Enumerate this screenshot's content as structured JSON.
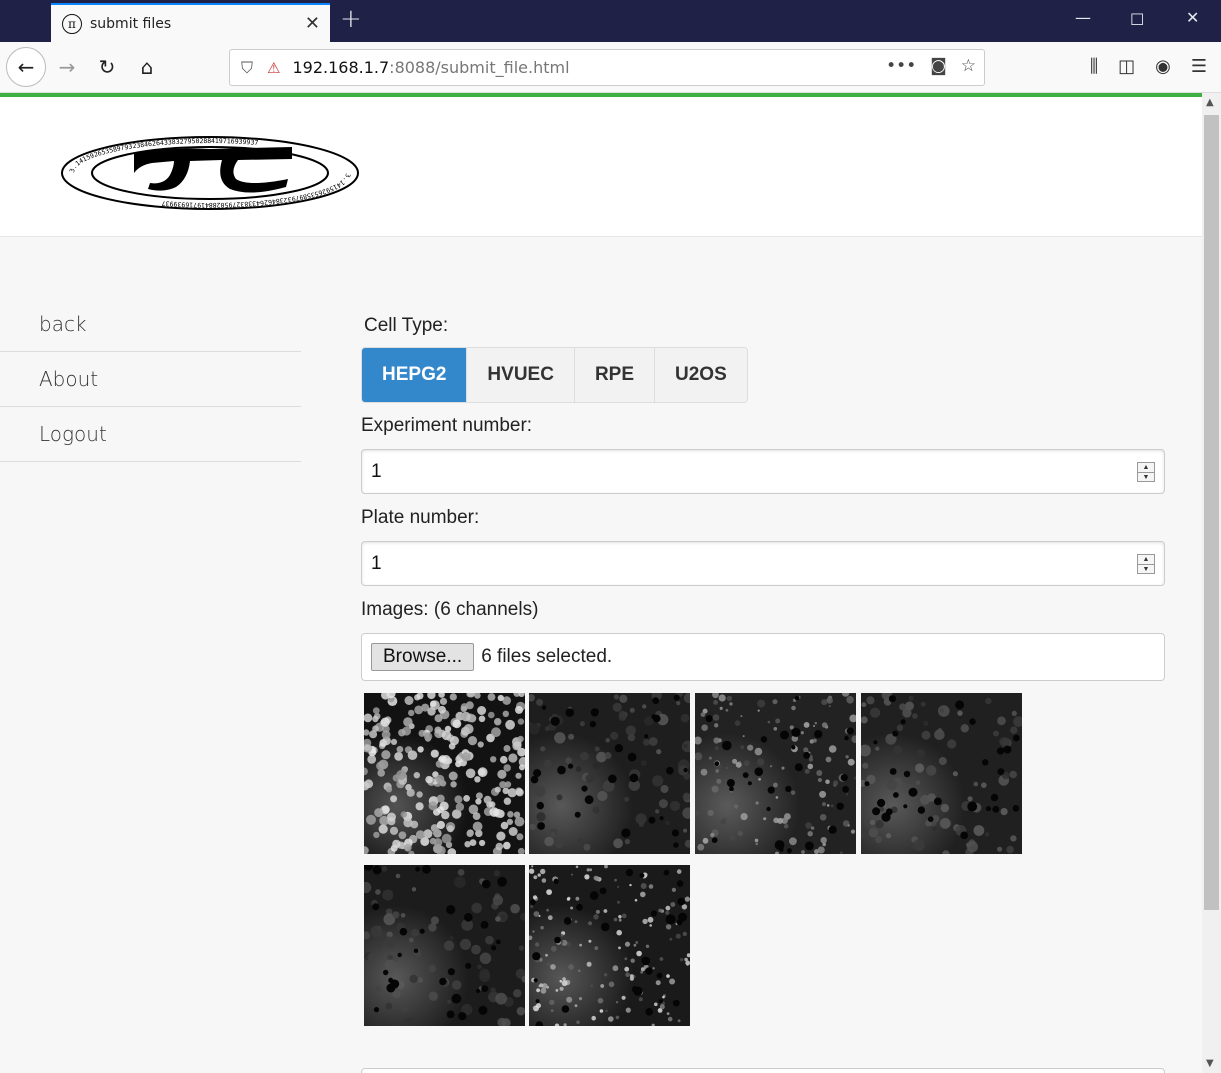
{
  "browser": {
    "tab_title": "submit files",
    "tab_favicon": "π",
    "url_host": "192.168.1.7",
    "url_rest": ":8088/submit_file.html"
  },
  "sidebar": {
    "items": [
      {
        "label": "back"
      },
      {
        "label": "About"
      },
      {
        "label": "Logout"
      }
    ]
  },
  "form": {
    "cell_type_label": "Cell Type:",
    "cell_types": [
      "HEPG2",
      "HVUEC",
      "RPE",
      "U2OS"
    ],
    "cell_type_selected": "HEPG2",
    "experiment_label": "Experiment number:",
    "experiment_value": "1",
    "plate_label": "Plate number:",
    "plate_value": "1",
    "images_label": "Images: (6 channels)",
    "browse_label": "Browse...",
    "file_status": "6 files selected."
  },
  "logo": {
    "digits_top": "3.14159265358979323846264338327950288419716939937",
    "digits_bottom": "3.14159265358979323846264338327950288419716939937"
  },
  "colors": {
    "accent": "#3388cc",
    "loadbar": "#3cb043",
    "titlebar": "#1f2147"
  }
}
